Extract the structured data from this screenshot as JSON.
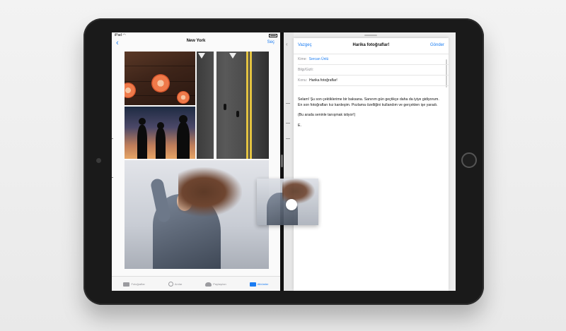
{
  "photos": {
    "nav": {
      "back_icon": "chevron-left-icon",
      "title": "New York",
      "subtitle": "",
      "select_label": "Seç"
    },
    "tabs": [
      {
        "label": "Fotoğraflar",
        "icon": "photos-icon",
        "active": false
      },
      {
        "label": "Anılar",
        "icon": "memories-icon",
        "active": false
      },
      {
        "label": "Paylaşılan",
        "icon": "cloud-icon",
        "active": false
      },
      {
        "label": "Albümler",
        "icon": "albums-icon",
        "active": true
      }
    ]
  },
  "mail": {
    "cancel_label": "Vazgeç",
    "title": "Harika fotoğraflar!",
    "send_label": "Gönder",
    "to_label": "Kime:",
    "to_value": "Sercan Ünlü",
    "cc_label": "Bilgi/Gizli:",
    "subject_label": "Konu:",
    "subject_value": "Harika fotoğraflar!",
    "body": [
      "Selam! Şu son çektiklerime bir baksana. Sanırım gün geçtikçe daha da iyiye gidiyorum. En son fotoğrafları kız kardeşim. Pozlama özelliğini kullandım ve gerçekten işe yaradı.",
      "(Bu arada seninle tanışmak istiyor!)",
      "E."
    ]
  },
  "colors": {
    "accent": "#1a7cf2",
    "device": "#1a1a1a"
  }
}
